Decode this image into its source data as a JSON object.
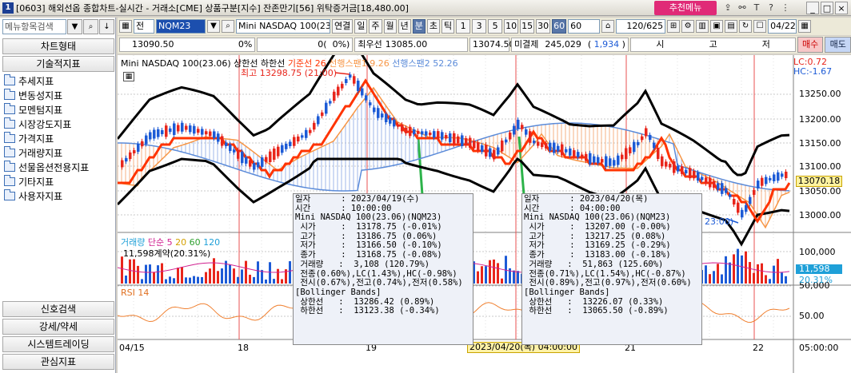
{
  "window": {
    "badge": "1",
    "title": "[0603] 해외선옵 종합차트-실시간 - 거래소[CME] 상품구분[지수] 잔존만기[56] 위탁증거금[18,480.00]",
    "recommend_menu": "추천메뉴"
  },
  "sidebar": {
    "search_placeholder": "메뉴항목검색",
    "header_top": "차트형태",
    "header_indicators": "기술적지표",
    "tree": [
      "추세지표",
      "변동성지표",
      "모멘텀지표",
      "시장강도지표",
      "가격지표",
      "거래량지표",
      "선물옵션전용지표",
      "기타지표",
      "사용자지표"
    ],
    "bottom": [
      "신호검색",
      "강세/약세",
      "시스템트레이딩",
      "관심지표"
    ]
  },
  "toolbar": {
    "type_label": "전",
    "symbol": "NQM23",
    "product_name": "Mini NASDAQ 100(23.0",
    "buttons": [
      "연결",
      "일",
      "주",
      "월",
      "년",
      "분",
      "초",
      "틱"
    ],
    "timeframes": [
      "1",
      "3",
      "5",
      "10",
      "15",
      "30",
      "60"
    ],
    "selected_timeframe": "60",
    "period_select": "60",
    "count": "120/625",
    "date": "04/22"
  },
  "quote_bar": {
    "price": "13090.50",
    "change_pct": "0%",
    "volume": "0",
    "vol_pct": "0%",
    "best_bid_label": "최우선",
    "best_bid": "13085.00",
    "best_ask": "13074.50",
    "open_int_label": "미결제",
    "open_int": "245,029",
    "open_int_chg": "1,934",
    "hilo_label": "시",
    "high_label": "고",
    "low_label": "저",
    "buy": "매수",
    "sell": "매도"
  },
  "price_pane": {
    "legend": [
      {
        "label": "Mini NASDAQ 100(23.06)",
        "color": "#000000"
      },
      {
        "label": "상한선",
        "color": "#000000"
      },
      {
        "label": "하한선",
        "color": "#000000"
      },
      {
        "label": "기준선 26",
        "color": "#ff3300"
      },
      {
        "label": "선행스팬1 9.26",
        "color": "#f79646"
      },
      {
        "label": "선행스팬2 52.26",
        "color": "#5b8bd9"
      }
    ],
    "lc": "LC:0.72",
    "hc": "HC:-1.67",
    "high_note": "최고 13298.75 (21:00)",
    "low_note": "23:00)",
    "current_price": "13070.18",
    "y_ticks": [
      "13250.00",
      "13200.00",
      "13150.00",
      "13100.00",
      "13050.00",
      "13000.00"
    ]
  },
  "volume_pane": {
    "legend": [
      {
        "label": "거래량",
        "color": "#1fa0d8"
      },
      {
        "label": "단순",
        "color": "#d02090"
      },
      {
        "label": "5",
        "color": "#d02090"
      },
      {
        "label": "20",
        "color": "#d4a000"
      },
      {
        "label": "60",
        "color": "#2ea02e"
      },
      {
        "label": "120",
        "color": "#1fa0d8"
      }
    ],
    "sub_label": "11,598계약(20.31%)",
    "y_ticks": [
      "100,000",
      "50,000"
    ],
    "current": "11,598",
    "current_pct": "20.31%"
  },
  "rsi_pane": {
    "legend": "RSI 14",
    "y_tick": "50.00"
  },
  "x_axis": {
    "labels": [
      "04/15",
      "18",
      "19",
      "21",
      "22"
    ],
    "cursor_label": "2023/04/20(목) 04:00:00",
    "right_label": "05:00:00"
  },
  "tooltips": [
    {
      "rows": [
        "일자      : 2023/04/19(수)",
        "시간      : 10:00:00",
        "Mini NASDAQ 100(23.06)(NQM23)",
        " 시가     :  13178.75 (-0.01%)",
        " 고가     :  13186.75 (0.06%)",
        " 저가     :  13166.50 (-0.10%)",
        " 종가     :  13168.75 (-0.08%)",
        " 거래량   :  3,108 (120.79%)",
        " 전종(0.60%),LC(1.43%),HC(-0.98%)",
        " 전시(0.67%),전고(0.74%),전저(0.58%)",
        "[Bollinger Bands]",
        " 상한선   :  13286.42 (0.89%)",
        " 하한선   :  13123.38 (-0.34%)"
      ]
    },
    {
      "rows": [
        "일자      : 2023/04/20(목)",
        "시간      : 04:00:00",
        "Mini NASDAQ 100(23.06)(NQM23)",
        " 시가     :  13207.00 (-0.00%)",
        " 고가     :  13217.25 (0.08%)",
        " 저가     :  13169.25 (-0.29%)",
        " 종가     :  13183.00 (-0.18%)",
        " 거래량   :  51,863 (125.60%)",
        " 전종(0.71%),LC(1.54%),HC(-0.87%)",
        " 전시(0.89%),전고(0.97%),전저(0.60%)",
        "[Bollinger Bands]",
        " 상한선   :  13226.07 (0.33%)",
        " 하한선   :  13065.50 (-0.89%)"
      ]
    }
  ],
  "colors": {
    "up": "#e8261c",
    "down": "#1d5bd6",
    "kijun": "#ff3300",
    "span1": "#f79646",
    "span2": "#5b8bd9",
    "bollinger": "#000000",
    "cloud": "#9fb7e8"
  }
}
